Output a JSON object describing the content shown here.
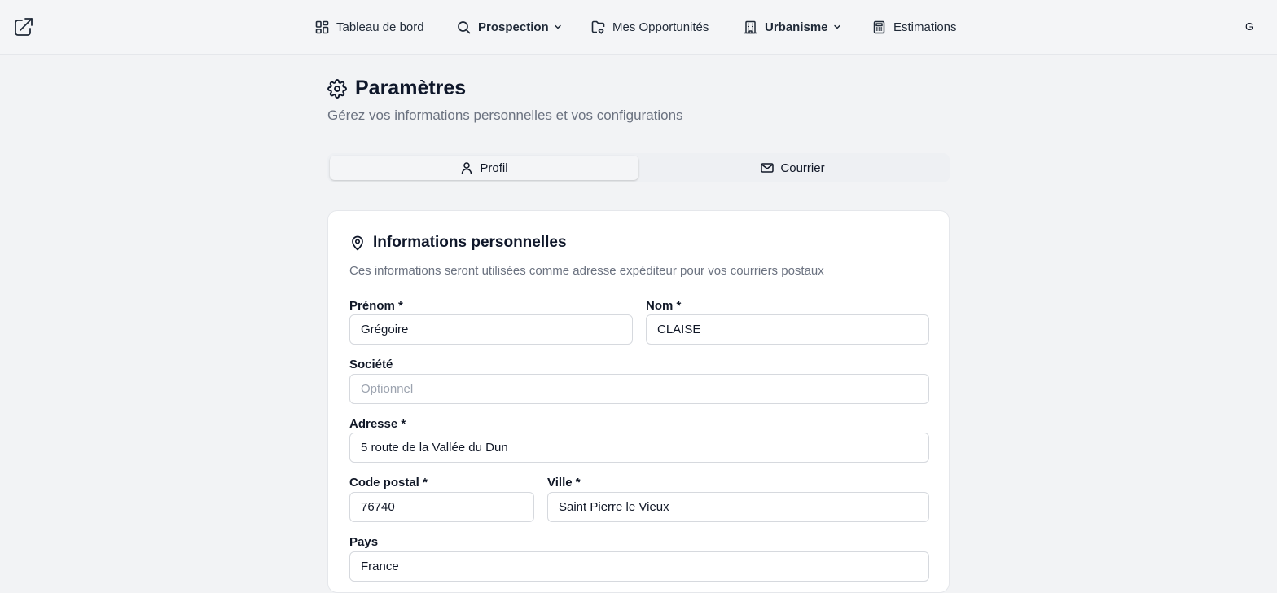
{
  "header": {
    "logo_icon": "external-link-arrow-icon",
    "nav": [
      {
        "label": "Tableau de bord",
        "icon": "dashboard-icon",
        "dropdown": false
      },
      {
        "label": "Prospection",
        "icon": "search-icon",
        "dropdown": true
      },
      {
        "label": "Mes Opportunités",
        "icon": "folder-heart-icon",
        "dropdown": false
      },
      {
        "label": "Urbanisme",
        "icon": "building-icon",
        "dropdown": true
      },
      {
        "label": "Estimations",
        "icon": "calculator-icon",
        "dropdown": false
      }
    ],
    "avatar_initial": "G"
  },
  "page": {
    "title": "Paramètres",
    "subtitle": "Gérez vos informations personnelles et vos configurations"
  },
  "tabs": [
    {
      "label": "Profil",
      "icon": "user-icon",
      "active": true
    },
    {
      "label": "Courrier",
      "icon": "mail-icon",
      "active": false
    }
  ],
  "card": {
    "title": "Informations personnelles",
    "icon": "map-pin-icon",
    "description": "Ces informations seront utilisées comme adresse expéditeur pour vos courriers postaux",
    "fields": {
      "prenom": {
        "label": "Prénom *",
        "value": "Grégoire",
        "placeholder": ""
      },
      "nom": {
        "label": "Nom *",
        "value": "CLAISE",
        "placeholder": ""
      },
      "societe": {
        "label": "Société",
        "value": "",
        "placeholder": "Optionnel"
      },
      "adresse": {
        "label": "Adresse *",
        "value": "5 route de la Vallée du Dun",
        "placeholder": ""
      },
      "code_postal": {
        "label": "Code postal *",
        "value": "76740",
        "placeholder": ""
      },
      "ville": {
        "label": "Ville *",
        "value": "Saint Pierre le Vieux",
        "placeholder": ""
      },
      "pays": {
        "label": "Pays",
        "value": "France",
        "placeholder": ""
      }
    }
  },
  "colors": {
    "background": "#f2f3f5",
    "card": "#ffffff",
    "text": "#111827",
    "muted": "#6b7280",
    "border": "#d6d9de"
  }
}
